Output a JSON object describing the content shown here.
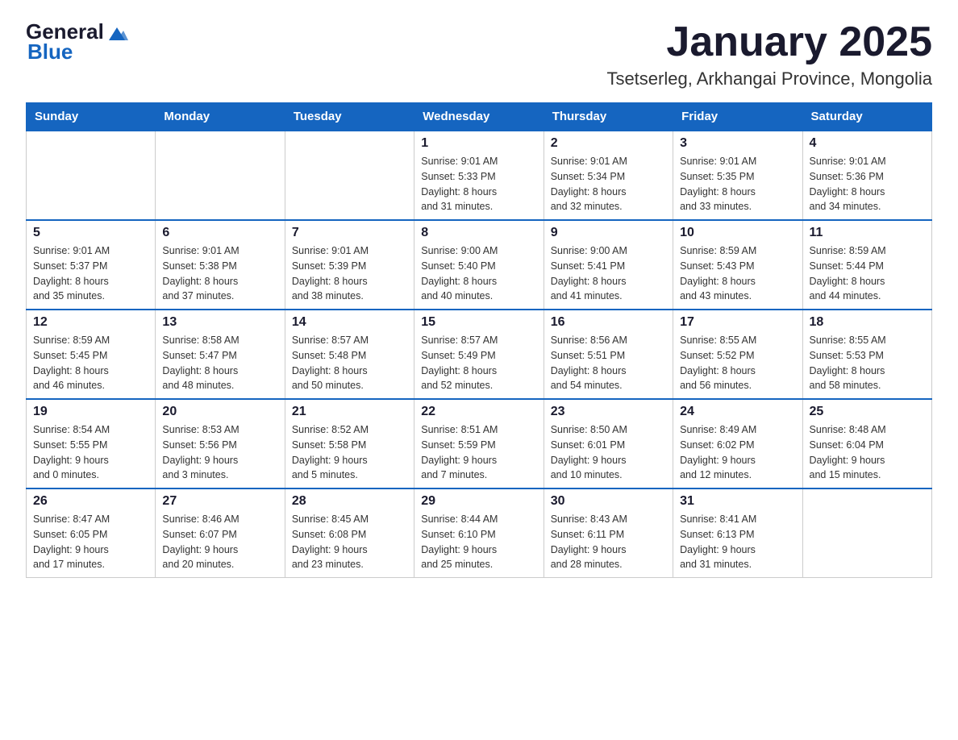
{
  "logo": {
    "general": "General",
    "blue": "Blue"
  },
  "title": "January 2025",
  "subtitle": "Tsetserleg, Arkhangai Province, Mongolia",
  "weekdays": [
    "Sunday",
    "Monday",
    "Tuesday",
    "Wednesday",
    "Thursday",
    "Friday",
    "Saturday"
  ],
  "weeks": [
    [
      {
        "day": "",
        "info": ""
      },
      {
        "day": "",
        "info": ""
      },
      {
        "day": "",
        "info": ""
      },
      {
        "day": "1",
        "info": "Sunrise: 9:01 AM\nSunset: 5:33 PM\nDaylight: 8 hours\nand 31 minutes."
      },
      {
        "day": "2",
        "info": "Sunrise: 9:01 AM\nSunset: 5:34 PM\nDaylight: 8 hours\nand 32 minutes."
      },
      {
        "day": "3",
        "info": "Sunrise: 9:01 AM\nSunset: 5:35 PM\nDaylight: 8 hours\nand 33 minutes."
      },
      {
        "day": "4",
        "info": "Sunrise: 9:01 AM\nSunset: 5:36 PM\nDaylight: 8 hours\nand 34 minutes."
      }
    ],
    [
      {
        "day": "5",
        "info": "Sunrise: 9:01 AM\nSunset: 5:37 PM\nDaylight: 8 hours\nand 35 minutes."
      },
      {
        "day": "6",
        "info": "Sunrise: 9:01 AM\nSunset: 5:38 PM\nDaylight: 8 hours\nand 37 minutes."
      },
      {
        "day": "7",
        "info": "Sunrise: 9:01 AM\nSunset: 5:39 PM\nDaylight: 8 hours\nand 38 minutes."
      },
      {
        "day": "8",
        "info": "Sunrise: 9:00 AM\nSunset: 5:40 PM\nDaylight: 8 hours\nand 40 minutes."
      },
      {
        "day": "9",
        "info": "Sunrise: 9:00 AM\nSunset: 5:41 PM\nDaylight: 8 hours\nand 41 minutes."
      },
      {
        "day": "10",
        "info": "Sunrise: 8:59 AM\nSunset: 5:43 PM\nDaylight: 8 hours\nand 43 minutes."
      },
      {
        "day": "11",
        "info": "Sunrise: 8:59 AM\nSunset: 5:44 PM\nDaylight: 8 hours\nand 44 minutes."
      }
    ],
    [
      {
        "day": "12",
        "info": "Sunrise: 8:59 AM\nSunset: 5:45 PM\nDaylight: 8 hours\nand 46 minutes."
      },
      {
        "day": "13",
        "info": "Sunrise: 8:58 AM\nSunset: 5:47 PM\nDaylight: 8 hours\nand 48 minutes."
      },
      {
        "day": "14",
        "info": "Sunrise: 8:57 AM\nSunset: 5:48 PM\nDaylight: 8 hours\nand 50 minutes."
      },
      {
        "day": "15",
        "info": "Sunrise: 8:57 AM\nSunset: 5:49 PM\nDaylight: 8 hours\nand 52 minutes."
      },
      {
        "day": "16",
        "info": "Sunrise: 8:56 AM\nSunset: 5:51 PM\nDaylight: 8 hours\nand 54 minutes."
      },
      {
        "day": "17",
        "info": "Sunrise: 8:55 AM\nSunset: 5:52 PM\nDaylight: 8 hours\nand 56 minutes."
      },
      {
        "day": "18",
        "info": "Sunrise: 8:55 AM\nSunset: 5:53 PM\nDaylight: 8 hours\nand 58 minutes."
      }
    ],
    [
      {
        "day": "19",
        "info": "Sunrise: 8:54 AM\nSunset: 5:55 PM\nDaylight: 9 hours\nand 0 minutes."
      },
      {
        "day": "20",
        "info": "Sunrise: 8:53 AM\nSunset: 5:56 PM\nDaylight: 9 hours\nand 3 minutes."
      },
      {
        "day": "21",
        "info": "Sunrise: 8:52 AM\nSunset: 5:58 PM\nDaylight: 9 hours\nand 5 minutes."
      },
      {
        "day": "22",
        "info": "Sunrise: 8:51 AM\nSunset: 5:59 PM\nDaylight: 9 hours\nand 7 minutes."
      },
      {
        "day": "23",
        "info": "Sunrise: 8:50 AM\nSunset: 6:01 PM\nDaylight: 9 hours\nand 10 minutes."
      },
      {
        "day": "24",
        "info": "Sunrise: 8:49 AM\nSunset: 6:02 PM\nDaylight: 9 hours\nand 12 minutes."
      },
      {
        "day": "25",
        "info": "Sunrise: 8:48 AM\nSunset: 6:04 PM\nDaylight: 9 hours\nand 15 minutes."
      }
    ],
    [
      {
        "day": "26",
        "info": "Sunrise: 8:47 AM\nSunset: 6:05 PM\nDaylight: 9 hours\nand 17 minutes."
      },
      {
        "day": "27",
        "info": "Sunrise: 8:46 AM\nSunset: 6:07 PM\nDaylight: 9 hours\nand 20 minutes."
      },
      {
        "day": "28",
        "info": "Sunrise: 8:45 AM\nSunset: 6:08 PM\nDaylight: 9 hours\nand 23 minutes."
      },
      {
        "day": "29",
        "info": "Sunrise: 8:44 AM\nSunset: 6:10 PM\nDaylight: 9 hours\nand 25 minutes."
      },
      {
        "day": "30",
        "info": "Sunrise: 8:43 AM\nSunset: 6:11 PM\nDaylight: 9 hours\nand 28 minutes."
      },
      {
        "day": "31",
        "info": "Sunrise: 8:41 AM\nSunset: 6:13 PM\nDaylight: 9 hours\nand 31 minutes."
      },
      {
        "day": "",
        "info": ""
      }
    ]
  ]
}
